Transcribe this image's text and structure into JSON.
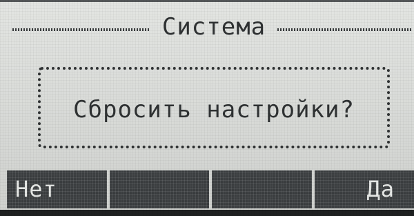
{
  "screen": {
    "title": "Система"
  },
  "dialog": {
    "message": "Сбросить настройки?"
  },
  "softkeys": [
    {
      "label": "Нет"
    },
    {
      "label": ""
    },
    {
      "label": ""
    },
    {
      "label": "Да"
    }
  ]
}
